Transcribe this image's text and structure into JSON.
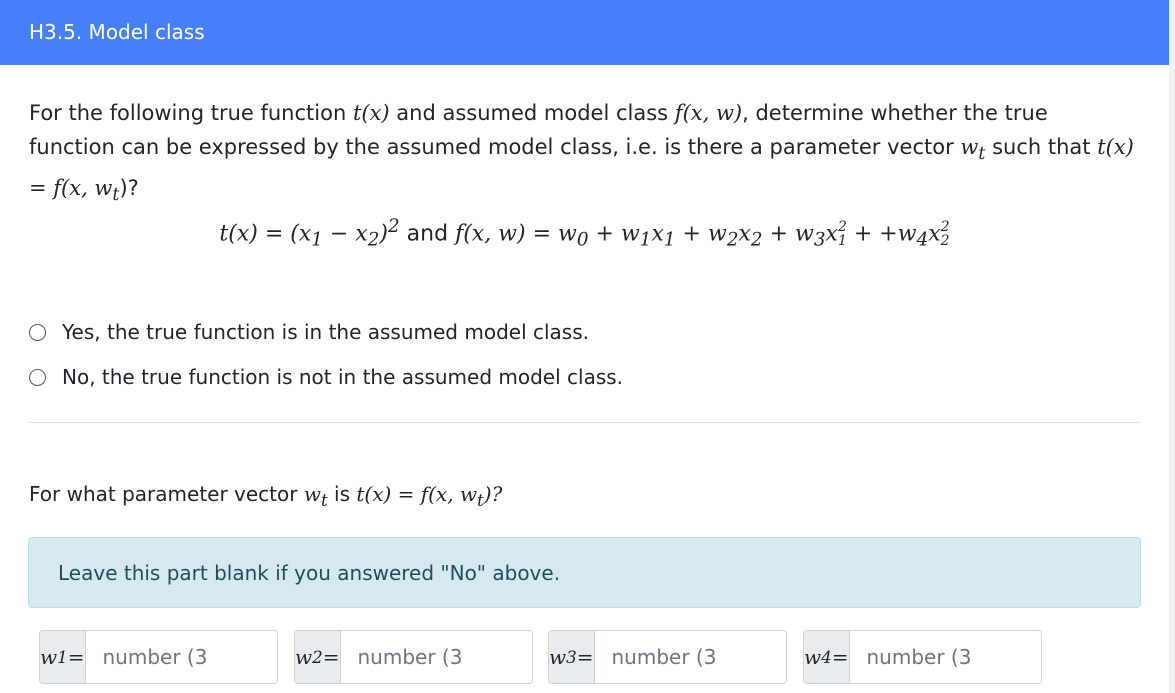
{
  "header": {
    "title": "H3.5. Model class"
  },
  "question1": {
    "lead": "For the following true function ",
    "t_x": "t(x)",
    "mid1": " and assumed model class ",
    "f_xw": "f(x, w)",
    "mid2": ", determine whether the true function can be expressed by the assumed model class, i.e. is there a parameter vector ",
    "w_t": "w",
    "w_t_sub": "t",
    "mid3": " such that ",
    "equation": "t(x) = f(x, w",
    "equation_sub": "t",
    "tail": ")?"
  },
  "display_equation": {
    "lhs": "t(x) = (x",
    "lhs_sub1": "1",
    "lhs_minus": " − x",
    "lhs_sub2": "2",
    "lhs_close": ")",
    "lhs_pow": "2",
    "and": " and ",
    "rhs_start": "f(x, w) = w",
    "s0": "0",
    "p1": " + w",
    "s1a": "1",
    "p1x": "x",
    "s1b": "1",
    "p2": " + w",
    "s2a": "2",
    "p2x": "x",
    "s2b": "2",
    "p3": " + w",
    "s3a": "3",
    "p3x": "x",
    "s3sup": "2",
    "s3sub": "1",
    "p4": " + +w",
    "s4a": "4",
    "p4x": "x",
    "s4sup": "2",
    "s4sub": "2"
  },
  "options": [
    {
      "label": "Yes, the true function is in the assumed model class."
    },
    {
      "label": "No, the true function is not in the assumed model class."
    }
  ],
  "question2": {
    "lead": "For what parameter vector ",
    "w_t": "w",
    "w_t_sub": "t",
    "mid": " is ",
    "equation": "t(x) = f(x, w",
    "equation_sub": "t",
    "tail": ")?"
  },
  "info": {
    "text": "Leave this part blank if you answered \"No\" above."
  },
  "inputs": [
    {
      "var": "w",
      "sub": "1",
      "eq": " =",
      "placeholder": "number (3"
    },
    {
      "var": "w",
      "sub": "2",
      "eq": " =",
      "placeholder": "number (3"
    },
    {
      "var": "w",
      "sub": "3",
      "eq": " =",
      "placeholder": "number (3"
    },
    {
      "var": "w",
      "sub": "4",
      "eq": " =",
      "placeholder": "number (3"
    }
  ]
}
